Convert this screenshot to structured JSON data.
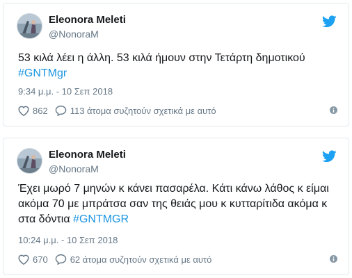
{
  "tweets": [
    {
      "author_name": "Eleonora Meleti",
      "handle": "@NonoraM",
      "text_lines": [
        "53 κιλά λέει η άλλη. 53 κιλά ήμουν στην Τετάρτη δημοτικού"
      ],
      "hashtag": "#GNTMgr",
      "timestamp": "9:34 μ.μ. - 10 Σεπ 2018",
      "likes": "862",
      "replies_text": "113 άτομα συζητούν σχετικά με αυτό"
    },
    {
      "author_name": "Eleonora Meleti",
      "handle": "@NonoraM",
      "text_lines": [
        "Έχει μωρό 7 μηνών κ κάνει πασαρέλα. Κάτι κάνω λάθος κ είμαι",
        "ακόμα 70 με μπράτσα σαν της θειάς μου κ κυτταρίτιδα ακόμα κ",
        "στα δόντια "
      ],
      "hashtag": "#GNTMGR",
      "timestamp": "10:24 μ.μ. - 10 Σεπ 2018",
      "likes": "670",
      "replies_text": "62 άτομα συζητούν σχετικά με αυτό"
    }
  ],
  "colors": {
    "text": "#14171a",
    "secondary": "#657786",
    "link": "#1b95e0",
    "twitter_blue": "#1da1f2",
    "border": "#e1e8ed"
  },
  "icons": [
    "avatar",
    "twitter-bird-icon",
    "heart-icon",
    "reply-bubble-icon",
    "info-icon"
  ]
}
